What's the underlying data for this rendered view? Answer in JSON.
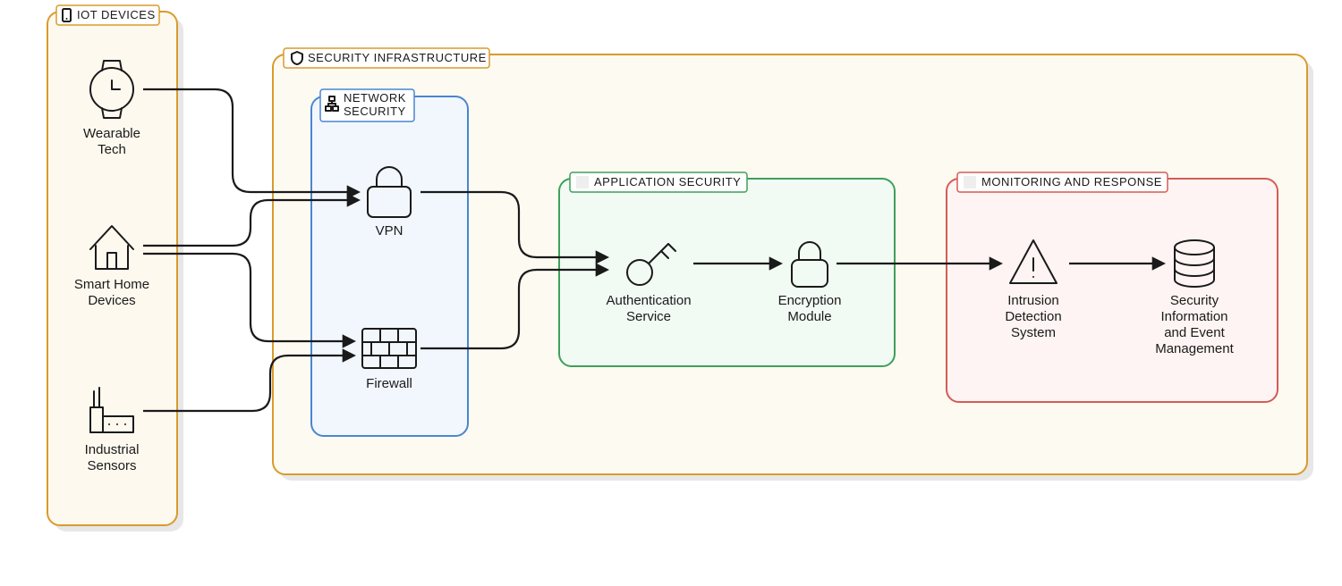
{
  "groups": {
    "iot": {
      "label": "IOT DEVICES"
    },
    "security": {
      "label": "SECURITY INFRASTRUCTURE"
    },
    "network": {
      "label": "NETWORK SECURITY"
    },
    "application": {
      "label": "APPLICATION SECURITY"
    },
    "monitoring": {
      "label": "MONITORING AND RESPONSE"
    }
  },
  "nodes": {
    "wearable": {
      "label1": "Wearable",
      "label2": "Tech"
    },
    "smarthome": {
      "label1": "Smart Home",
      "label2": "Devices"
    },
    "industrial": {
      "label1": "Industrial",
      "label2": "Sensors"
    },
    "vpn": {
      "label1": "VPN"
    },
    "firewall": {
      "label1": "Firewall"
    },
    "auth": {
      "label1": "Authentication",
      "label2": "Service"
    },
    "encryption": {
      "label1": "Encryption",
      "label2": "Module"
    },
    "ids": {
      "label1": "Intrusion",
      "label2": "Detection",
      "label3": "System"
    },
    "siem": {
      "label1": "Security",
      "label2": "Information",
      "label3": "and Event",
      "label4": "Management"
    }
  }
}
